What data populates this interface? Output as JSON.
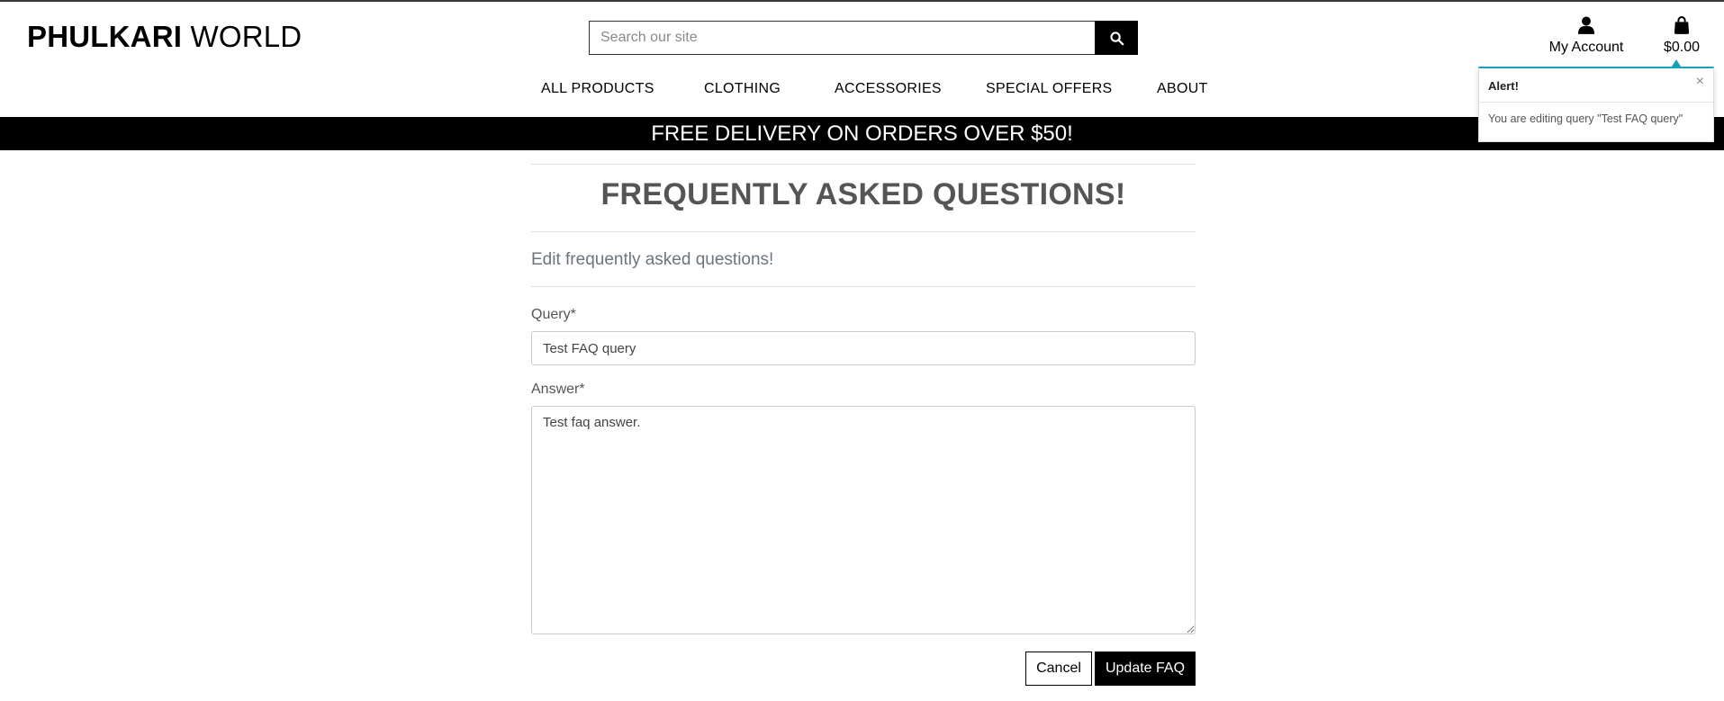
{
  "header": {
    "logo_bold": "PHULKARI",
    "logo_light": " WORLD",
    "search_placeholder": "Search our site",
    "account_label": "My Account",
    "bag_total": "$0.00"
  },
  "nav": {
    "items": [
      {
        "label": "ALL PRODUCTS"
      },
      {
        "label": "CLOTHING"
      },
      {
        "label": "ACCESSORIES"
      },
      {
        "label": "SPECIAL OFFERS"
      },
      {
        "label": "ABOUT"
      }
    ]
  },
  "banner": {
    "text": "FREE DELIVERY ON ORDERS OVER $50!"
  },
  "toast": {
    "title": "Alert!",
    "close": "×",
    "message": "You are editing query \"Test FAQ query\"",
    "accent_color": "#17a2b8"
  },
  "page": {
    "title": "FREQUENTLY ASKED QUESTIONS!",
    "subtitle": "Edit frequently asked questions!"
  },
  "form": {
    "query_label": "Query*",
    "query_value": "Test FAQ query",
    "answer_label": "Answer*",
    "answer_value": "Test faq answer.",
    "cancel_label": "Cancel",
    "submit_label": "Update FAQ"
  },
  "icons": {
    "search": "search-icon",
    "account": "user-icon",
    "bag": "shopping-bag-icon"
  }
}
